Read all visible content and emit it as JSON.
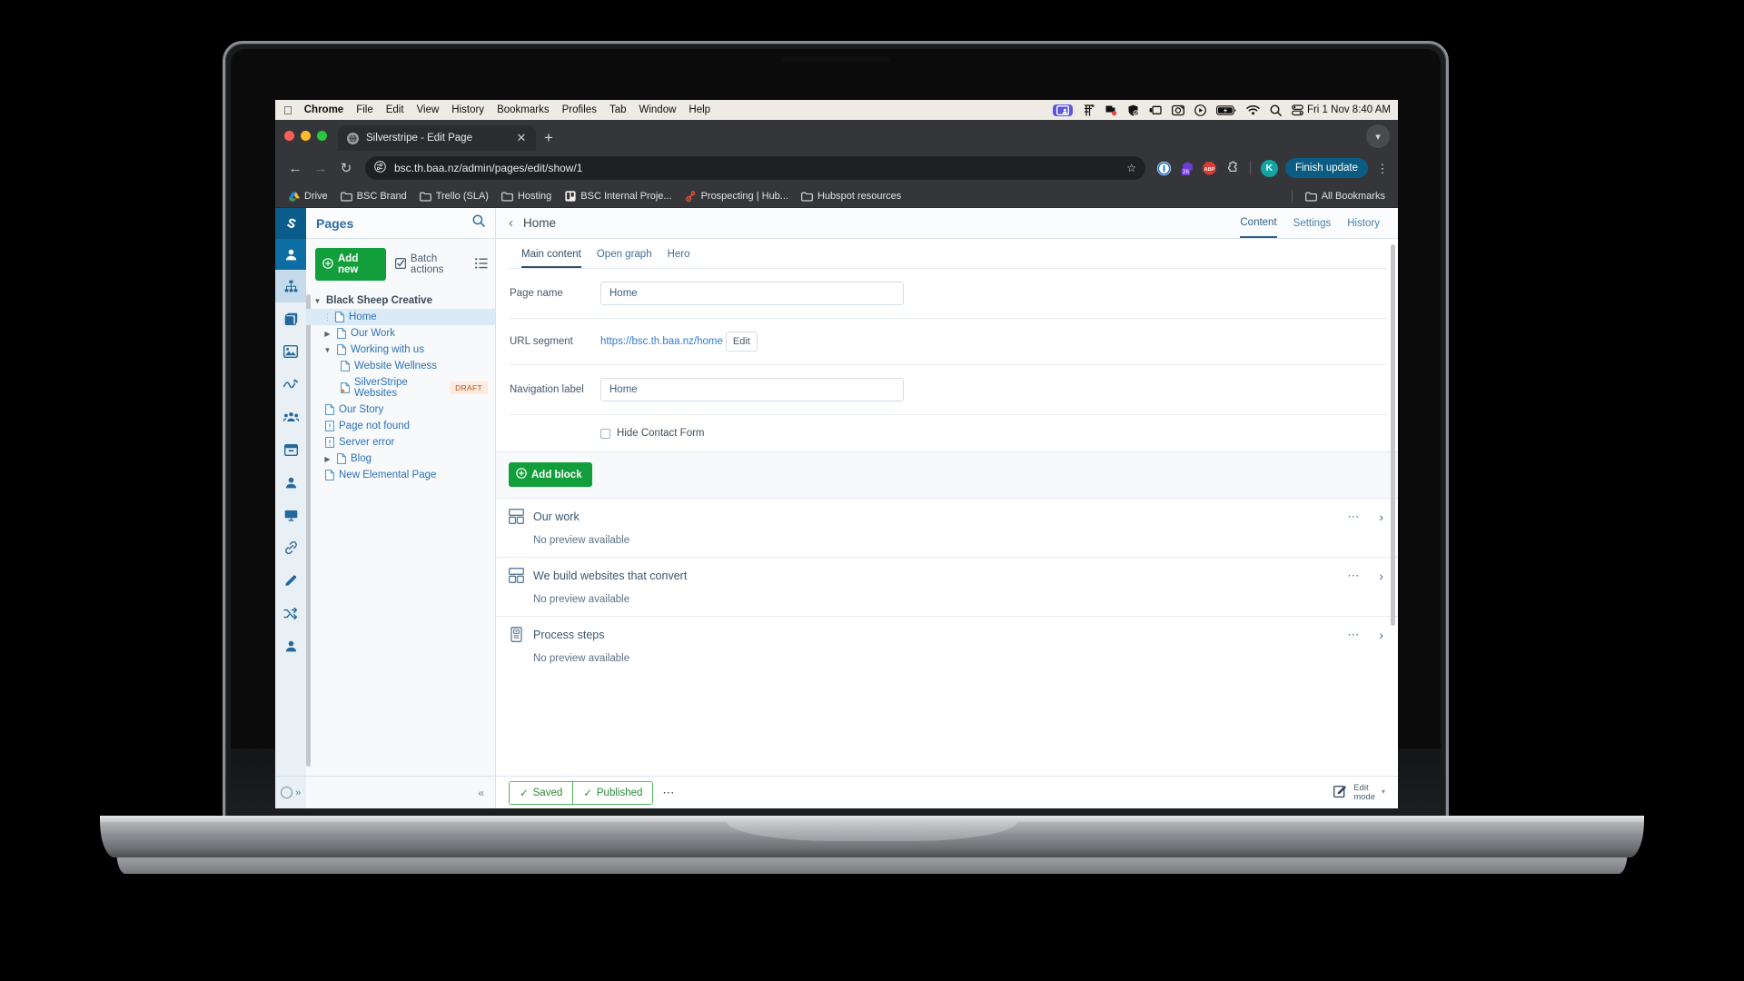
{
  "device": {
    "brand": "MacBook"
  },
  "menubar": {
    "apple_icon": "apple-logo-icon",
    "items": [
      {
        "label": "Chrome",
        "bold": true
      },
      {
        "label": "File",
        "bold": false
      },
      {
        "label": "Edit",
        "bold": false
      },
      {
        "label": "View",
        "bold": false
      },
      {
        "label": "History",
        "bold": false
      },
      {
        "label": "Bookmarks",
        "bold": false
      },
      {
        "label": "Profiles",
        "bold": false
      },
      {
        "label": "Tab",
        "bold": false
      },
      {
        "label": "Window",
        "bold": false
      },
      {
        "label": "Help",
        "bold": false
      }
    ],
    "tray_icons": [
      "screen-share-icon",
      "figma-icon",
      "microsoft-teams-icon",
      "shield-check-icon",
      "stage-manager-icon",
      "screenshot-icon",
      "control-center-icon",
      "battery-charging-icon",
      "wifi-icon",
      "spotlight-search-icon",
      "control-center-toggles-icon"
    ],
    "clock": "Fri 1 Nov  8:40 AM"
  },
  "browser": {
    "tab": {
      "title": "Silverstripe - Edit Page",
      "favicon": "globe-icon",
      "close_icon": "close-icon"
    },
    "new_tab_icon": "plus-icon",
    "window_chevron_icon": "chevron-down-icon",
    "nav": {
      "back_icon": "arrow-left-icon",
      "forward_icon": "arrow-right-icon",
      "reload_icon": "reload-icon",
      "site_info_icon": "site-settings-icon",
      "url": "bsc.th.baa.nz/admin/pages/edit/show/1",
      "bookmark_star_icon": "star-icon"
    },
    "extensions": [
      {
        "name": "onepassword-icon",
        "badge": ""
      },
      {
        "name": "grammarly-icon",
        "badge": "26"
      },
      {
        "name": "adblock-plus-icon",
        "badge": "ABP"
      },
      {
        "name": "extensions-puzzle-icon",
        "badge": ""
      }
    ],
    "profile_initial": "K",
    "update_button": "Finish update",
    "menu_icon": "kebab-menu-icon",
    "bookmarks": [
      {
        "label": "Drive",
        "icon": "google-drive-icon"
      },
      {
        "label": "BSC Brand",
        "icon": "folder-icon"
      },
      {
        "label": "Trello (SLA)",
        "icon": "folder-icon"
      },
      {
        "label": "Hosting",
        "icon": "folder-icon"
      },
      {
        "label": "BSC Internal Proje...",
        "icon": "trello-icon"
      },
      {
        "label": "Prospecting | Hub...",
        "icon": "hubspot-icon"
      },
      {
        "label": "Hubspot resources",
        "icon": "folder-icon"
      }
    ],
    "all_bookmarks": {
      "label": "All Bookmarks",
      "icon": "folder-icon"
    }
  },
  "cms": {
    "rail": {
      "logo_icon": "silverstripe-logo-icon",
      "user_icon": "user-icon",
      "items": [
        {
          "icon": "sitemap-pages-icon",
          "active": true
        },
        {
          "icon": "files-stack-icon",
          "active": false
        },
        {
          "icon": "image-gallery-icon",
          "active": false
        },
        {
          "icon": "reports-graph-icon",
          "active": false
        },
        {
          "icon": "groups-people-icon",
          "active": false
        },
        {
          "icon": "archive-box-icon",
          "active": false
        },
        {
          "icon": "single-user-icon",
          "active": false
        },
        {
          "icon": "screen-display-icon",
          "active": false
        },
        {
          "icon": "link-chain-icon",
          "active": false
        },
        {
          "icon": "pencil-edit-icon",
          "active": false
        },
        {
          "icon": "shuffle-redirect-icon",
          "active": false
        },
        {
          "icon": "member-profile-icon",
          "active": false
        }
      ],
      "bottom": {
        "circle_icon": "help-circle-icon",
        "expand_icon": "chevron-double-right-icon"
      }
    },
    "tree_panel": {
      "title": "Pages",
      "search_icon": "search-icon",
      "add_new": {
        "label": "Add new",
        "icon": "plus-circle-icon"
      },
      "batch_actions": {
        "label": "Batch actions",
        "icon": "checkbox-checked-icon"
      },
      "view_mode_icon": "list-view-icon",
      "root": {
        "label": "Black Sheep Creative",
        "caret": "▼"
      },
      "nodes": [
        {
          "label": "Home",
          "indent": 1,
          "caret": "",
          "page_icon": "page-icon",
          "selected": true,
          "grip": true,
          "badge": ""
        },
        {
          "label": "Our Work",
          "indent": 1,
          "caret": "▶",
          "page_icon": "page-icon",
          "selected": false,
          "grip": false,
          "badge": ""
        },
        {
          "label": "Working with us",
          "indent": 1,
          "caret": "▼",
          "page_icon": "page-icon",
          "selected": false,
          "grip": false,
          "badge": ""
        },
        {
          "label": "Website Wellness",
          "indent": 2,
          "caret": "",
          "page_icon": "page-icon",
          "selected": false,
          "grip": false,
          "badge": ""
        },
        {
          "label": "SilverStripe Websites",
          "indent": 2,
          "caret": "",
          "page_icon": "page-draft-icon",
          "selected": false,
          "grip": false,
          "badge": "DRAFT"
        },
        {
          "label": "Our Story",
          "indent": 1,
          "caret": "",
          "page_icon": "page-icon",
          "selected": false,
          "grip": false,
          "badge": ""
        },
        {
          "label": "Page not found",
          "indent": 1,
          "caret": "",
          "page_icon": "page-error-icon",
          "selected": false,
          "grip": false,
          "badge": ""
        },
        {
          "label": "Server error",
          "indent": 1,
          "caret": "",
          "page_icon": "page-error-icon",
          "selected": false,
          "grip": false,
          "badge": ""
        },
        {
          "label": "Blog",
          "indent": 1,
          "caret": "▶",
          "page_icon": "page-icon",
          "selected": false,
          "grip": false,
          "badge": ""
        },
        {
          "label": "New Elemental Page",
          "indent": 1,
          "caret": "",
          "page_icon": "page-icon",
          "selected": false,
          "grip": false,
          "badge": ""
        }
      ],
      "collapse_icon": "chevron-double-left-icon"
    },
    "editor": {
      "back_icon": "chevron-left-icon",
      "title": "Home",
      "top_tabs": [
        {
          "label": "Content",
          "active": true
        },
        {
          "label": "Settings",
          "active": false
        },
        {
          "label": "History",
          "active": false
        }
      ],
      "inner_tabs": [
        {
          "label": "Main content",
          "active": true
        },
        {
          "label": "Open graph",
          "active": false
        },
        {
          "label": "Hero",
          "active": false
        }
      ],
      "fields": {
        "page_name": {
          "label": "Page name",
          "value": "Home",
          "placeholder": ""
        },
        "url_segment": {
          "label": "URL segment",
          "value": "https://bsc.th.baa.nz/home",
          "edit_label": "Edit"
        },
        "navigation_label": {
          "label": "Navigation label",
          "value": "Home",
          "placeholder": ""
        },
        "hide_contact_form": {
          "label": "Hide Contact Form",
          "checked": false
        }
      },
      "add_block": {
        "label": "Add block",
        "icon": "plus-circle-icon"
      },
      "blocks": [
        {
          "title": "Our work",
          "preview": "No preview available",
          "icon": "content-block-icon",
          "menu_icon": "ellipsis-icon",
          "expand_icon": "chevron-right-icon"
        },
        {
          "title": "We build websites that convert",
          "preview": "No preview available",
          "icon": "content-block-icon",
          "menu_icon": "ellipsis-icon",
          "expand_icon": "chevron-right-icon"
        },
        {
          "title": "Process steps",
          "preview": "No preview available",
          "icon": "steps-block-icon",
          "menu_icon": "ellipsis-icon",
          "expand_icon": "chevron-right-icon"
        }
      ],
      "statusbar": {
        "saved": {
          "label": "Saved",
          "icon": "check-icon"
        },
        "published": {
          "label": "Published",
          "icon": "check-icon"
        },
        "more_icon": "ellipsis-icon",
        "edit_mode": {
          "line1": "Edit",
          "line2": "mode",
          "icon": "edit-mode-icon",
          "caret_icon": "caret-down-icon"
        }
      }
    }
  },
  "colors": {
    "silverstripe_blue": "#0b5c8a",
    "green_button": "#139e3c",
    "chrome_update_blue": "#0b5c83",
    "draft_badge_bg": "#fde9dd",
    "draft_badge_text": "#b35628",
    "status_green": "#2f8a3d"
  }
}
